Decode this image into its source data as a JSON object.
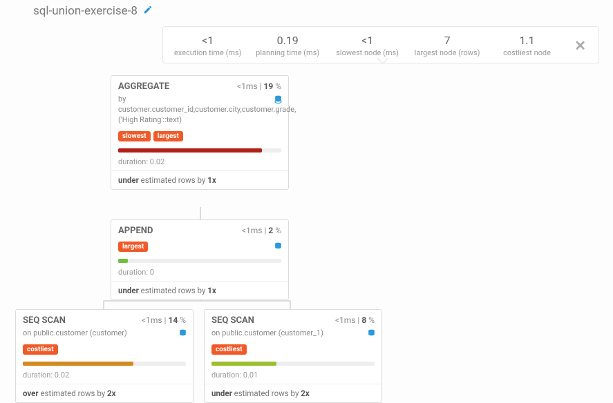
{
  "title": "sql-union-exercise-8",
  "stats": {
    "exec_val": "<1",
    "exec_label": "execution time (ms)",
    "plan_val": "0.19",
    "plan_label": "planning time (ms)",
    "slow_val": "<1",
    "slow_label": "slowest node (ms)",
    "large_val": "7",
    "large_label": "largest node (rows)",
    "cost_val": "1.1",
    "cost_label": "costliest node"
  },
  "nodes": {
    "aggregate": {
      "title": "AGGREGATE",
      "time": "<1ms",
      "pct": "19",
      "sub": "by customer.customer_id,customer.city,customer.grade,('High Rating'::text)",
      "tags": {
        "a": "slowest",
        "b": "largest"
      },
      "bar_color": "#b02016",
      "bar_pct": "88%",
      "duration": "duration: 0.02",
      "est_dir": "under",
      "est_txt": " estimated rows by ",
      "est_factor": "1"
    },
    "append": {
      "title": "APPEND",
      "time": "<1ms",
      "pct": "2",
      "tags": {
        "a": "largest"
      },
      "bar_color": "#6fbf3e",
      "bar_pct": "6%",
      "duration": "duration: 0",
      "est_dir": "under",
      "est_txt": " estimated rows by ",
      "est_factor": "1"
    },
    "seq1": {
      "title": "SEQ SCAN",
      "time": "<1ms",
      "pct": "14",
      "sub": "on public.customer (customer)",
      "tags": {
        "a": "costliest"
      },
      "bar_color": "#d38a1e",
      "bar_pct": "68%",
      "duration": "duration: 0.02",
      "est_dir": "over",
      "est_txt": " estimated rows by ",
      "est_factor": "2"
    },
    "seq2": {
      "title": "SEQ SCAN",
      "time": "<1ms",
      "pct": "8",
      "sub": "on public.customer (customer_1)",
      "tags": {
        "a": "costliest"
      },
      "bar_color": "#9bbf2e",
      "bar_pct": "40%",
      "duration": "duration: 0.01",
      "est_dir": "under",
      "est_txt": " estimated rows by ",
      "est_factor": "2"
    }
  },
  "x_suffix": "x",
  "pct_suffix": " %",
  "sep": " | "
}
